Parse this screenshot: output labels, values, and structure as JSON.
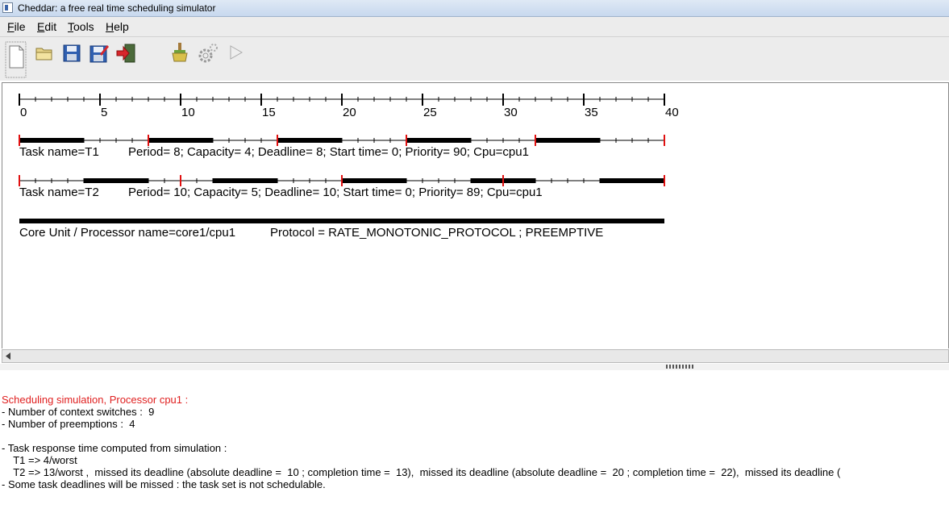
{
  "window": {
    "title": "Cheddar: a free real time scheduling simulator"
  },
  "menu": {
    "file": "File",
    "edit": "Edit",
    "tools": "Tools",
    "help": "Help"
  },
  "toolbar": {
    "items": [
      "new-file-icon",
      "open-folder-icon",
      "save-icon",
      "save-as-icon",
      "exit-icon",
      "clear-brush-icon",
      "settings-gear-icon",
      "run-play-icon"
    ]
  },
  "timeline": {
    "ticks": [
      "0",
      "5",
      "10",
      "15",
      "20",
      "25",
      "30",
      "35",
      "40"
    ],
    "tasks": [
      {
        "name": "T1",
        "label": "Task name=T1",
        "params": "Period= 8; Capacity= 4; Deadline= 8; Start time= 0; Priority= 90; Cpu=cpu1",
        "period": 8,
        "execution": [
          [
            0,
            4
          ],
          [
            8,
            12
          ],
          [
            16,
            20
          ],
          [
            24,
            28
          ],
          [
            32,
            36
          ]
        ]
      },
      {
        "name": "T2",
        "label": "Task name=T2",
        "params": "Period= 10; Capacity= 5; Deadline= 10; Start time= 0; Priority= 89; Cpu=cpu1",
        "period": 10,
        "execution": [
          [
            4,
            8
          ],
          [
            12,
            16
          ],
          [
            20,
            24
          ],
          [
            28,
            32
          ],
          [
            36,
            40
          ]
        ]
      }
    ],
    "processor": {
      "label": "Core Unit / Processor name=core1/cpu1",
      "protocol": "Protocol = RATE_MONOTONIC_PROTOCOL ; PREEMPTIVE"
    }
  },
  "console": {
    "header": "Scheduling simulation, Processor cpu1 :",
    "lines": [
      "- Number of context switches :  9",
      "- Number of preemptions :  4",
      "",
      "- Task response time computed from simulation :",
      "    T1 => 4/worst",
      "    T2 => 13/worst ,  missed its deadline (absolute deadline =  10 ; completion time =  13),  missed its deadline (absolute deadline =  20 ; completion time =  22),  missed its deadline (",
      "- Some task deadlines will be missed : the task set is not schedulable."
    ]
  },
  "colors": {
    "deadline_marker": "#e01010",
    "bar": "#000000",
    "console_header": "#e02020"
  }
}
